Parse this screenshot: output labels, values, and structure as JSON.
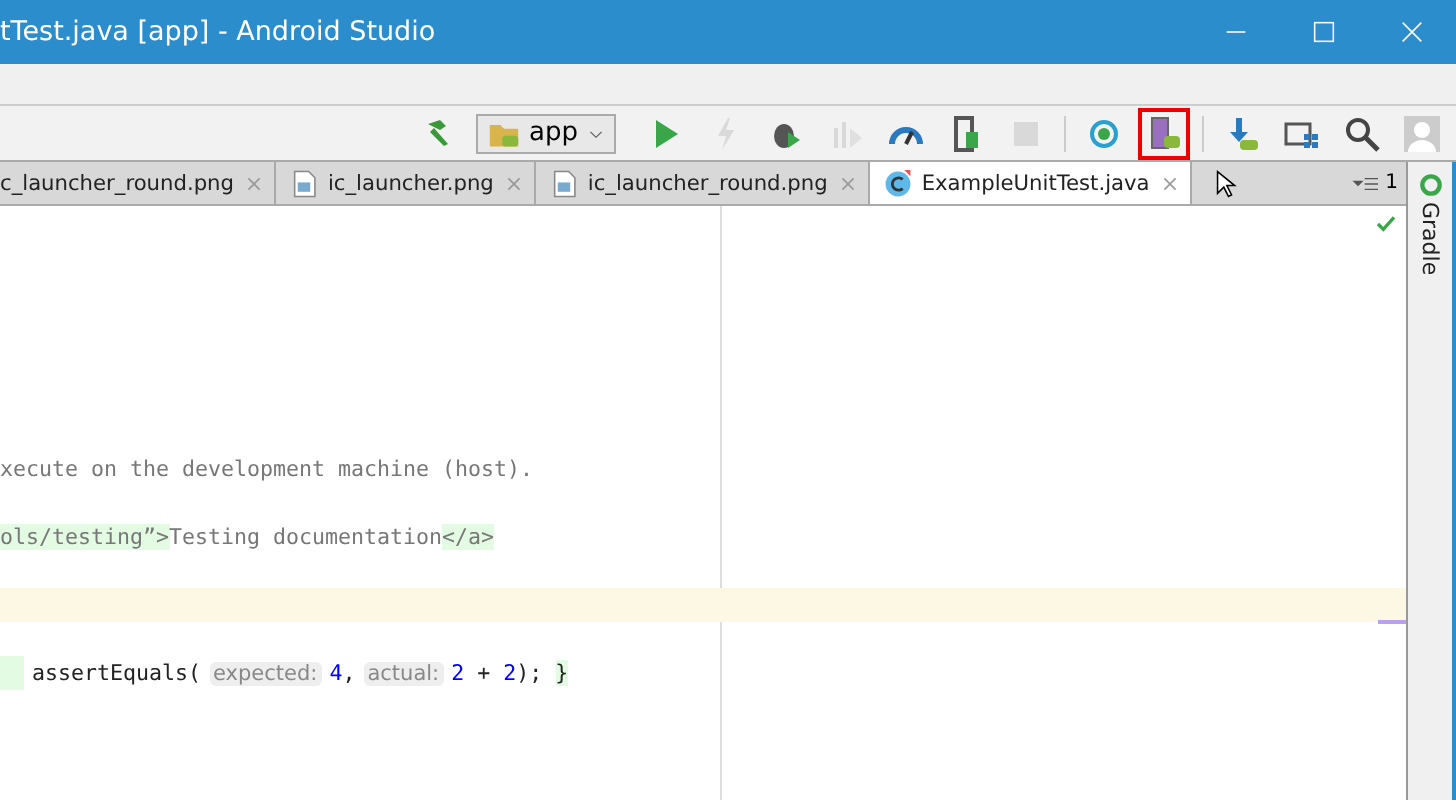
{
  "window": {
    "title": "tTest.java [app] - Android Studio"
  },
  "toolbar": [
    {
      "kind": "hammer",
      "disabled": false,
      "highlighted": false
    },
    {
      "kind": "config",
      "label": "app"
    },
    {
      "kind": "run",
      "disabled": false,
      "highlighted": false
    },
    {
      "kind": "bolt",
      "disabled": true,
      "highlighted": false
    },
    {
      "kind": "bug",
      "disabled": false,
      "highlighted": false
    },
    {
      "kind": "profile",
      "disabled": true,
      "highlighted": false
    },
    {
      "kind": "gauge",
      "disabled": false,
      "highlighted": false
    },
    {
      "kind": "attach",
      "disabled": false,
      "highlighted": false
    },
    {
      "kind": "stop",
      "disabled": true,
      "highlighted": false
    },
    {
      "kind": "sync",
      "disabled": false,
      "highlighted": false
    },
    {
      "kind": "device",
      "disabled": false,
      "highlighted": true
    },
    {
      "kind": "download",
      "disabled": false,
      "highlighted": false
    },
    {
      "kind": "structure",
      "disabled": false,
      "highlighted": false
    },
    {
      "kind": "search",
      "disabled": false,
      "highlighted": false
    },
    {
      "kind": "avatar",
      "disabled": false,
      "highlighted": false
    }
  ],
  "tabs": [
    {
      "label": "c_launcher_round.png",
      "kind": "cut",
      "selected": false
    },
    {
      "label": "ic_launcher.png",
      "kind": "image",
      "selected": false
    },
    {
      "label": "ic_launcher_round.png",
      "kind": "image",
      "selected": false
    },
    {
      "label": "ExampleUnitTest.java",
      "kind": "class",
      "selected": true
    }
  ],
  "tab_count": "1",
  "side_panel": {
    "label": "Gradle"
  },
  "editor": {
    "lines": [
      {
        "current": false,
        "segments": [
          {
            "kind": "comment",
            "text": "xecute on the development machine (host)."
          }
        ]
      },
      {
        "current": false,
        "segments": [
          {
            "kind": "tag",
            "text": "ols/testing”>"
          },
          {
            "kind": "comment",
            "text": "Testing documentation"
          },
          {
            "kind": "tag",
            "text": "</a>"
          }
        ]
      },
      {
        "current": true
      },
      {
        "current": false,
        "segments": [
          {
            "kind": "code",
            "text": "assertEquals("
          },
          {
            "kind": "hint",
            "text": "expected:"
          },
          {
            "kind": "number",
            "text": "4"
          },
          {
            "kind": "code",
            "text": ","
          },
          {
            "kind": "hint",
            "text": "actual:"
          },
          {
            "kind": "number",
            "text": "2"
          },
          {
            "kind": "code",
            "text": " + "
          },
          {
            "kind": "number",
            "text": "2"
          },
          {
            "kind": "code",
            "text": "); "
          },
          {
            "kind": "brace",
            "text": "}"
          }
        ]
      }
    ]
  }
}
